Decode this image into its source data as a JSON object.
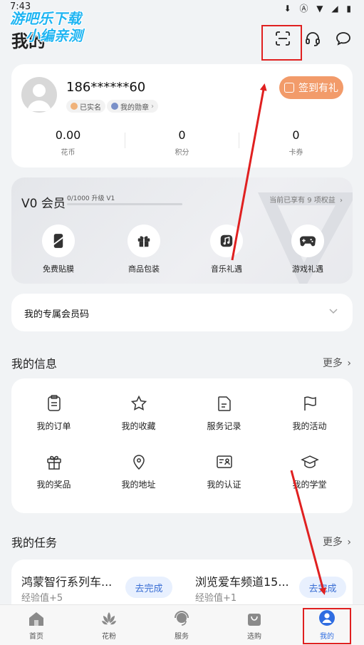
{
  "status_bar": {
    "time": "7:43",
    "icons": "⬇ Ⓐ ▼ ◢ ▮"
  },
  "watermark": {
    "line1": "游吧乐下载",
    "line2": "小编亲测"
  },
  "header": {
    "title": "我的"
  },
  "profile": {
    "phone": "186******60",
    "tag_verified": "已实名",
    "tag_badge": "我的勋章",
    "signin_label": "签到有礼",
    "stats": [
      {
        "value": "0.00",
        "label": "花币"
      },
      {
        "value": "0",
        "label": "积分"
      },
      {
        "value": "0",
        "label": "卡券"
      }
    ]
  },
  "vip": {
    "title": "V0 会员",
    "progress_text": "0/1000 升级 V1",
    "progress_fraction": 0.0,
    "rights_text": "当前已享有 9 项权益",
    "items": [
      {
        "label": "免费贴膜",
        "icon": "phone-film-icon"
      },
      {
        "label": "商品包装",
        "icon": "gift-box-icon"
      },
      {
        "label": "音乐礼遇",
        "icon": "music-note-icon"
      },
      {
        "label": "游戏礼遇",
        "icon": "gamepad-icon"
      }
    ]
  },
  "member_code": {
    "label": "我的专属会员码"
  },
  "info": {
    "title": "我的信息",
    "more": "更多",
    "items": [
      {
        "label": "我的订单",
        "icon": "clipboard-icon"
      },
      {
        "label": "我的收藏",
        "icon": "star-icon"
      },
      {
        "label": "服务记录",
        "icon": "document-icon"
      },
      {
        "label": "我的活动",
        "icon": "flag-icon"
      },
      {
        "label": "我的奖品",
        "icon": "gift-icon"
      },
      {
        "label": "我的地址",
        "icon": "location-pin-icon"
      },
      {
        "label": "我的认证",
        "icon": "id-card-icon"
      },
      {
        "label": "我的学堂",
        "icon": "graduation-cap-icon"
      }
    ]
  },
  "tasks": {
    "title": "我的任务",
    "more": "更多",
    "items": [
      {
        "title": "鸿蒙智行系列车...",
        "sub": "经验值+5",
        "button": "去完成"
      },
      {
        "title": "浏览爱车频道15...",
        "sub": "经验值+1",
        "button": "去完成"
      }
    ]
  },
  "tabs": [
    {
      "label": "首页",
      "icon": "home-icon"
    },
    {
      "label": "花粉",
      "icon": "lotus-icon"
    },
    {
      "label": "服务",
      "icon": "headset-service-icon"
    },
    {
      "label": "选购",
      "icon": "shopping-bag-icon"
    },
    {
      "label": "我的",
      "icon": "user-profile-icon",
      "active": true
    }
  ],
  "colors": {
    "accent": "#2f6de1",
    "signin": "#f29b6a",
    "annotation": "#e02020"
  }
}
